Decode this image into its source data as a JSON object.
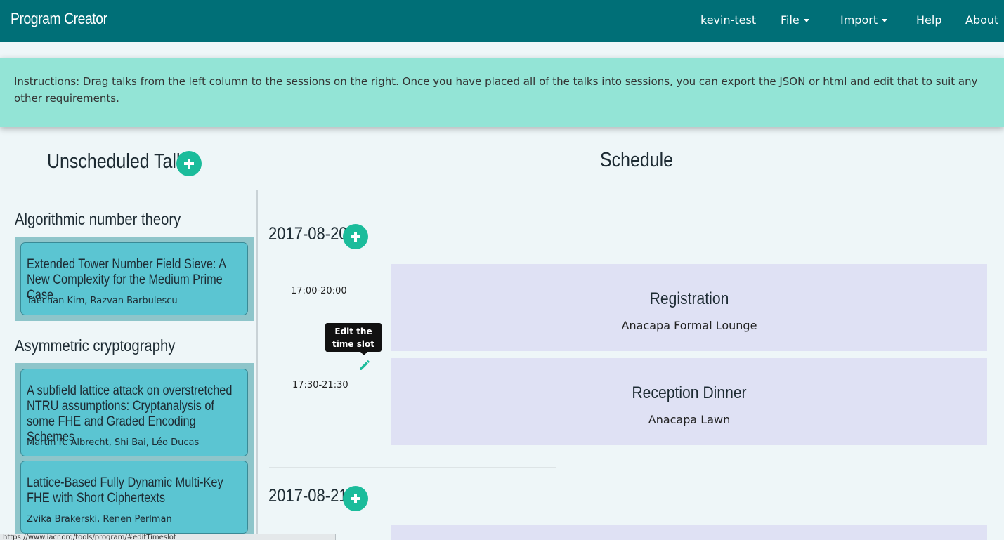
{
  "navbar": {
    "brand": "Program Creator",
    "user": "kevin-test",
    "file": "File",
    "import": "Import",
    "help": "Help",
    "about": "About"
  },
  "instructions": "Instructions: Drag talks from the left column to the sessions on the right. Once you have placed all of the talks into sessions, you can export the JSON or html and edit that to suit any other requirements.",
  "unscheduled": {
    "heading": "Unscheduled Talks",
    "categories": [
      {
        "name": "Algorithmic number theory",
        "talks": [
          {
            "title": "Extended Tower Number Field Sieve: A New Complexity for the Medium Prime Case",
            "authors": "Taechan Kim, Razvan Barbulescu"
          }
        ]
      },
      {
        "name": "Asymmetric cryptography",
        "talks": [
          {
            "title": "A subfield lattice attack on overstretched NTRU assumptions: Cryptanalysis of some FHE and Graded Encoding Schemes",
            "authors": "Martin R. Albrecht, Shi Bai, Léo Ducas"
          },
          {
            "title": "Lattice-Based Fully Dynamic Multi-Key FHE with Short Ciphertexts",
            "authors": "Zvika Brakerski, Renen Perlman"
          }
        ]
      }
    ]
  },
  "schedule": {
    "heading": "Schedule",
    "days": [
      {
        "date": "2017-08-20",
        "slots": [
          {
            "time": "17:00-20:00",
            "title": "Registration",
            "location": "Anacapa Formal Lounge"
          },
          {
            "time": "17:30-21:30",
            "title": "Reception Dinner",
            "location": "Anacapa Lawn"
          }
        ]
      },
      {
        "date": "2017-08-21",
        "slots": []
      }
    ]
  },
  "tooltip": "Edit the time slot",
  "status_url": "https://www.iacr.org/tools/program/#editTimeslot",
  "icons": {
    "add": "plus-icon",
    "edit": "pencil-icon"
  },
  "colors": {
    "navbar": "#006f77",
    "instructions": "#93e4d6",
    "accent": "#1bbc9b",
    "talk": "#5bc5d2",
    "session": "#dfe1f4"
  }
}
